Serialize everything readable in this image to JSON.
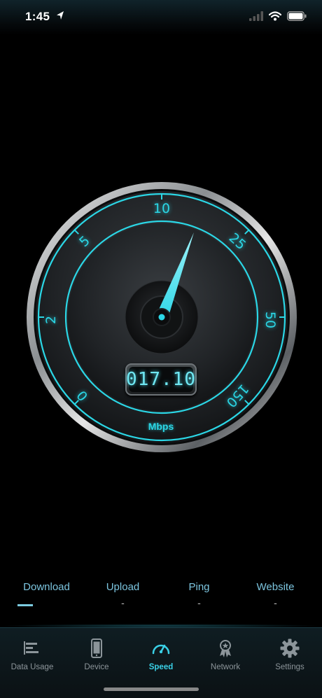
{
  "status": {
    "time": "1:45"
  },
  "gauge": {
    "scale_labels": [
      "0",
      "2",
      "5",
      "10",
      "25",
      "50",
      "150"
    ],
    "readout": "017.10",
    "unit": "Mbps",
    "speed_value": 17.1
  },
  "results": [
    {
      "label": "Download",
      "value": ""
    },
    {
      "label": "Upload",
      "value": "-"
    },
    {
      "label": "Ping",
      "value": "-"
    },
    {
      "label": "Website",
      "value": "-"
    }
  ],
  "tabs": [
    {
      "label": "Data Usage",
      "icon": "data-usage-icon"
    },
    {
      "label": "Device",
      "icon": "phone-icon"
    },
    {
      "label": "Speed",
      "icon": "speedometer-icon"
    },
    {
      "label": "Network",
      "icon": "network-icon"
    },
    {
      "label": "Settings",
      "icon": "gear-icon"
    }
  ],
  "active_tab": "Speed",
  "colors": {
    "accent": "#2bd7e6",
    "background": "#000000",
    "tab_inactive": "#8c959a"
  }
}
